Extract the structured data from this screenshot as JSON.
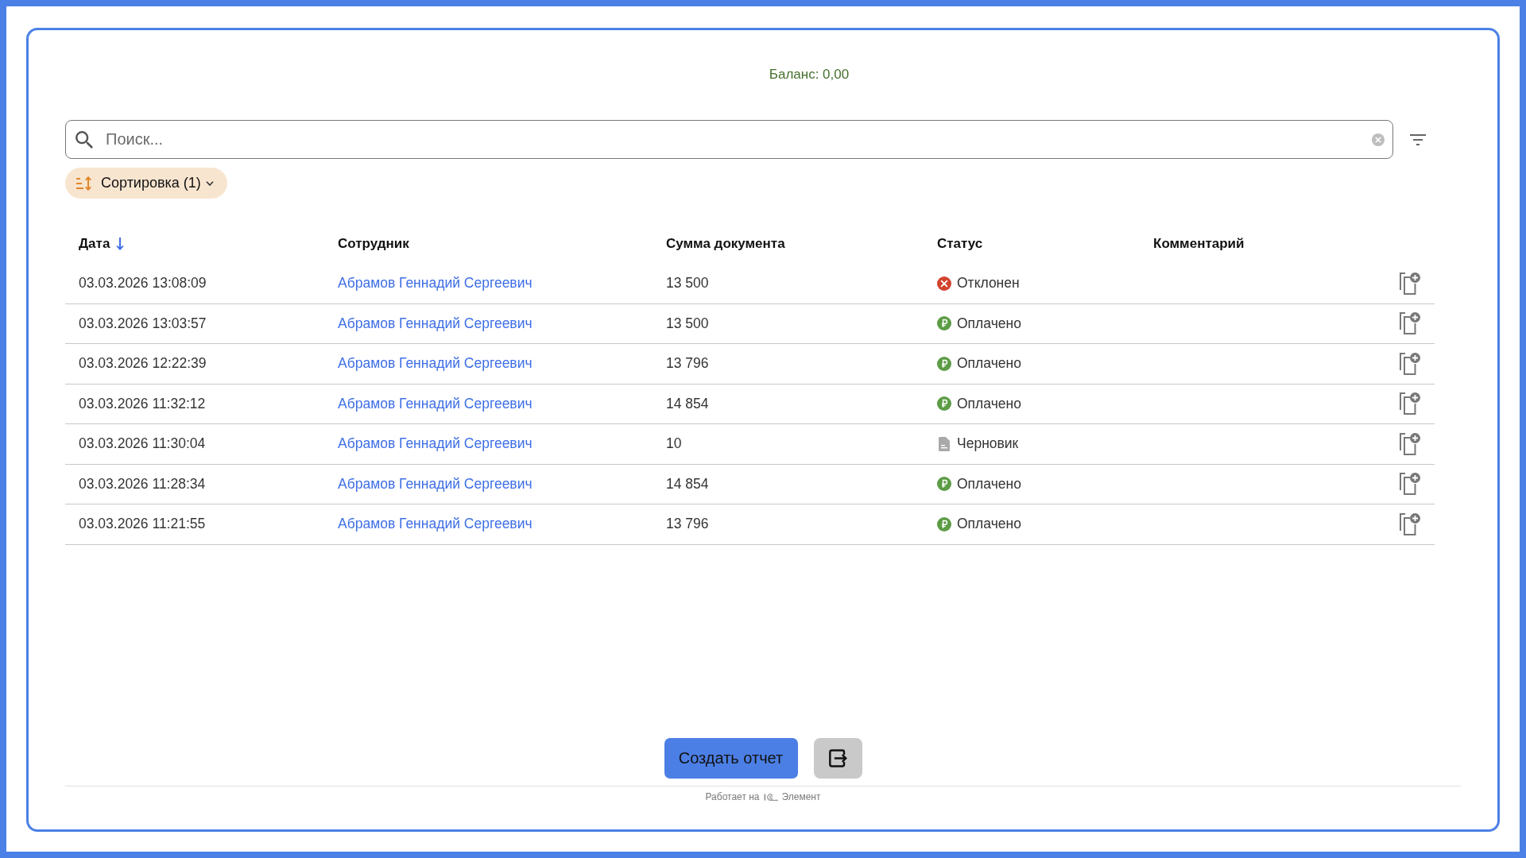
{
  "balance": "Баланс: 0,00",
  "search": {
    "placeholder": "Поиск..."
  },
  "sort_chip": {
    "label": "Сортировка (1)"
  },
  "table": {
    "columns": [
      {
        "label": "Дата",
        "sorted": true
      },
      {
        "label": "Сотрудник",
        "sorted": false
      },
      {
        "label": "Сумма документа",
        "sorted": false
      },
      {
        "label": "Статус",
        "sorted": false
      },
      {
        "label": "Комментарий",
        "sorted": false
      }
    ],
    "rows": [
      {
        "date": "03.03.2026 13:08:09",
        "employee": "Абрамов Геннадий Сергеевич",
        "amount": "13 500",
        "status": {
          "label": "Отклонен",
          "kind": "rejected"
        }
      },
      {
        "date": "03.03.2026 13:03:57",
        "employee": "Абрамов Геннадий Сергеевич",
        "amount": "13 500",
        "status": {
          "label": "Оплачено",
          "kind": "paid"
        }
      },
      {
        "date": "03.03.2026 12:22:39",
        "employee": "Абрамов Геннадий Сергеевич",
        "amount": "13 796",
        "status": {
          "label": "Оплачено",
          "kind": "paid"
        }
      },
      {
        "date": "03.03.2026 11:32:12",
        "employee": "Абрамов Геннадий Сергеевич",
        "amount": "14 854",
        "status": {
          "label": "Оплачено",
          "kind": "paid"
        }
      },
      {
        "date": "03.03.2026 11:30:04",
        "employee": "Абрамов Геннадий Сергеевич",
        "amount": "10",
        "status": {
          "label": "Черновик",
          "kind": "draft"
        }
      },
      {
        "date": "03.03.2026 11:28:34",
        "employee": "Абрамов Геннадий Сергеевич",
        "amount": "14 854",
        "status": {
          "label": "Оплачено",
          "kind": "paid"
        }
      },
      {
        "date": "03.03.2026 11:21:55",
        "employee": "Абрамов Геннадий Сергеевич",
        "amount": "13 796",
        "status": {
          "label": "Оплачено",
          "kind": "paid"
        }
      }
    ]
  },
  "report_button": {
    "label": "Создать отчет"
  },
  "footer": {
    "prefix": "Работает на",
    "product": "Элемент"
  }
}
